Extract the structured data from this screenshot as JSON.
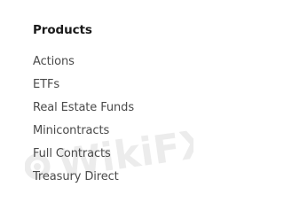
{
  "menu": {
    "heading": "Products",
    "items": [
      {
        "label": "Actions"
      },
      {
        "label": "ETFs"
      },
      {
        "label": "Real Estate Funds"
      },
      {
        "label": "Minicontracts"
      },
      {
        "label": "Full Contracts"
      },
      {
        "label": "Treasury Direct"
      }
    ]
  },
  "watermark": {
    "text": "WikiFX",
    "icon": "wikifx-logo-icon"
  },
  "colors": {
    "background": "#ffffff",
    "heading": "#1a1a1a",
    "item": "#4a4a4a"
  }
}
